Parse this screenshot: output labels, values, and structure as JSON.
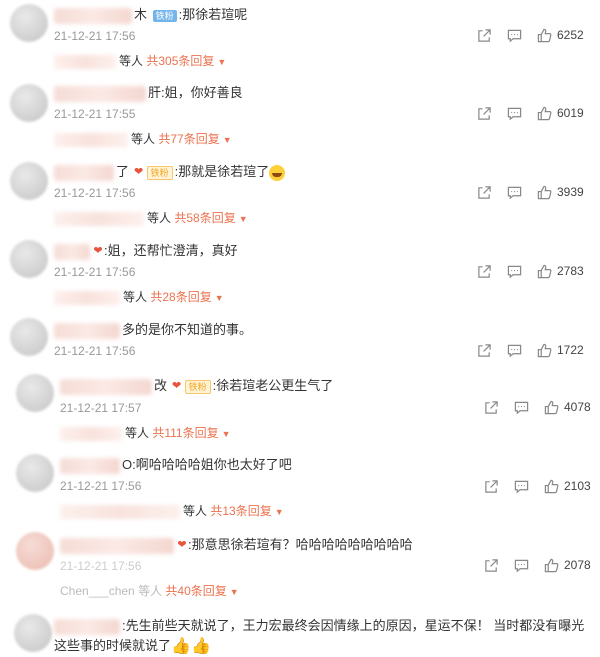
{
  "comments": [
    {
      "name_tail": "木",
      "badge": "铁粉",
      "text": ":那徐若瑄呢",
      "time": "21-12-21 17:56",
      "likes": "6252",
      "reply_tail": "等人",
      "reply_count": "共305条回复"
    },
    {
      "name_tail": "肝",
      "badge": "",
      "text": ":姐，你好善良",
      "time": "21-12-21 17:55",
      "likes": "6019",
      "reply_tail": "等人",
      "reply_count": "共77条回复"
    },
    {
      "name_tail": "了",
      "badge": "铁粉",
      "text": ":那就是徐若瑄了",
      "time": "21-12-21 17:56",
      "likes": "3939",
      "reply_tail": "等人",
      "reply_count": "共58条回复"
    },
    {
      "name_tail": "",
      "badge": "",
      "text": ":姐，还帮忙澄清，真好",
      "time": "21-12-21 17:56",
      "likes": "2783",
      "reply_tail": "等人",
      "reply_count": "共28条回复"
    },
    {
      "name_tail": "",
      "badge": "",
      "text": "多的是你不知道的事。",
      "time": "21-12-21 17:56",
      "likes": "1722",
      "reply_tail": "",
      "reply_count": ""
    },
    {
      "name_tail": "改",
      "badge": "铁粉",
      "text": ":徐若瑄老公更生气了",
      "time": "21-12-21 17:57",
      "likes": "4078",
      "reply_tail": "等人",
      "reply_count": "共111条回复"
    },
    {
      "name_tail": "O",
      "badge": "",
      "text": ":啊哈哈哈哈姐你也太好了吧",
      "time": "21-12-21 17:56",
      "likes": "2103",
      "reply_tail": "等人",
      "reply_count": "共13条回复"
    },
    {
      "name_tail": "",
      "badge": "",
      "text": ":那意思徐若瑄有？哈哈哈哈哈哈哈哈哈",
      "time": "21-12-21 17:56",
      "likes": "2078",
      "reply_tail": "Chen___chen 等人",
      "reply_count": "共40条回复"
    }
  ],
  "last_comment": {
    "text": ":先生前些天就说了，王力宏最终会因情缘上的原因，星运不保！ 当时都没有曝光这些事的时候就说了"
  }
}
